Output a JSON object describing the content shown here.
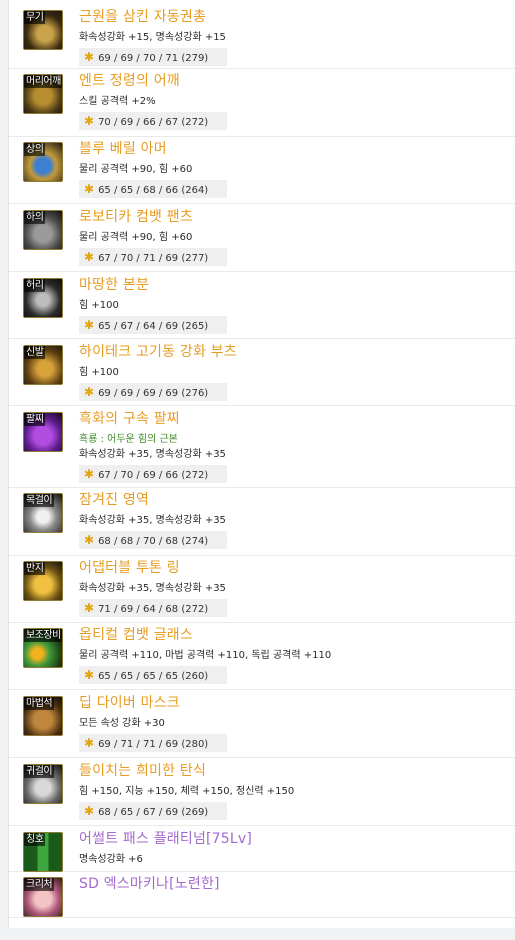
{
  "colors": {
    "orange": "#e79c22",
    "purple": "#a26acd"
  },
  "items": [
    {
      "slot": "무기",
      "name": "근원을 삼킨 자동권총",
      "lines": [
        "화속성강화 +15, 명속성강화 +15"
      ],
      "stats": "69 / 69 / 70 / 71 (279)",
      "rarity": "orange",
      "icon": "pistol-icon"
    },
    {
      "slot": "머리어깨",
      "name": "엔트 정령의 어깨",
      "lines": [
        "스킬 공격력 +2%"
      ],
      "stats": "70 / 69 / 66 / 67 (272)",
      "rarity": "orange",
      "icon": "shoulder-icon"
    },
    {
      "slot": "상의",
      "name": "블루 베릴 아머",
      "lines": [
        "물리 공격력 +90, 힘 +60"
      ],
      "stats": "65 / 65 / 68 / 66 (264)",
      "rarity": "orange",
      "icon": "armor-icon"
    },
    {
      "slot": "하의",
      "name": "로보티카 컴뱃 팬츠",
      "lines": [
        "물리 공격력 +90, 힘 +60"
      ],
      "stats": "67 / 70 / 71 / 69 (277)",
      "rarity": "orange",
      "icon": "pants-icon"
    },
    {
      "slot": "허리",
      "name": "마땅한 본분",
      "lines": [
        "힘 +100"
      ],
      "stats": "65 / 67 / 64 / 69 (265)",
      "rarity": "orange",
      "icon": "belt-icon"
    },
    {
      "slot": "신발",
      "name": "하이테크 고기동 강화 부츠",
      "lines": [
        "힘 +100"
      ],
      "stats": "69 / 69 / 69 / 69 (276)",
      "rarity": "orange",
      "icon": "boots-icon"
    },
    {
      "slot": "팔찌",
      "name": "흑화의 구속 팔찌",
      "lines": [
        "흑룡 : 어두운 힘의 근본",
        "화속성강화 +35, 명속성강화 +35"
      ],
      "green": [
        true,
        false
      ],
      "stats": "67 / 70 / 69 / 66 (272)",
      "rarity": "orange",
      "icon": "bracelet-icon"
    },
    {
      "slot": "목걸이",
      "name": "잠겨진 영역",
      "lines": [
        "화속성강화 +35, 명속성강화 +35"
      ],
      "stats": "68 / 68 / 70 / 68 (274)",
      "rarity": "orange",
      "icon": "necklace-icon"
    },
    {
      "slot": "반지",
      "name": "어댑터블 투톤 링",
      "lines": [
        "화속성강화 +35, 명속성강화 +35"
      ],
      "stats": "71 / 69 / 64 / 68 (272)",
      "rarity": "orange",
      "icon": "ring-icon"
    },
    {
      "slot": "보조장비",
      "name": "옵티컬 컴뱃 글래스",
      "lines": [
        "물리 공격력 +110, 마법 공격력 +110, 독립 공격력 +110"
      ],
      "stats": "65 / 65 / 65 / 65 (260)",
      "rarity": "orange",
      "icon": "glasses-icon"
    },
    {
      "slot": "마법석",
      "name": "딥 다이버 마스크",
      "lines": [
        "모든 속성 강화 +30"
      ],
      "stats": "69 / 71 / 71 / 69 (280)",
      "rarity": "orange",
      "icon": "mask-icon"
    },
    {
      "slot": "귀걸이",
      "name": "들이치는 희미한 탄식",
      "lines": [
        "힘 +150, 지능 +150, 체력 +150, 정신력 +150"
      ],
      "stats": "68 / 65 / 67 / 69 (269)",
      "rarity": "orange",
      "icon": "earring-icon"
    },
    {
      "slot": "칭호",
      "name": "어썰트 패스 플래티넘[75Lv]",
      "lines": [
        "명속성강화 +6"
      ],
      "stats": "",
      "rarity": "purple",
      "icon": "title-icon"
    },
    {
      "slot": "크리처",
      "name": "SD 엑스마키나[노련한]",
      "lines": [],
      "stats": "",
      "rarity": "purple",
      "icon": "creature-icon"
    }
  ]
}
